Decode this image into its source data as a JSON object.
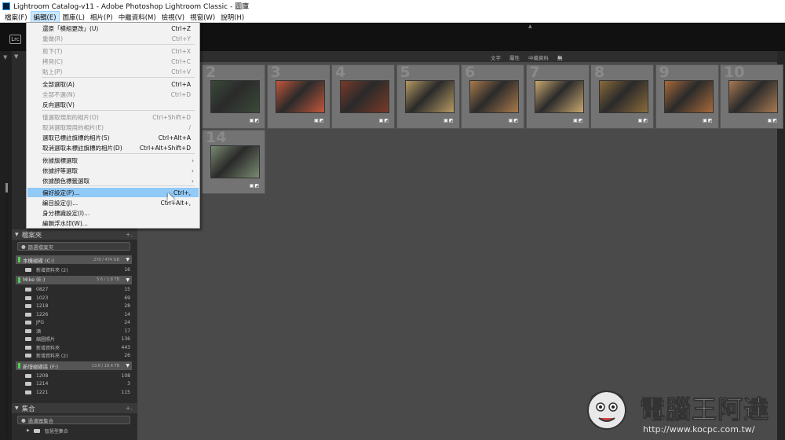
{
  "window": {
    "title": "Lightroom Catalog-v11 - Adobe Photoshop Lightroom Classic - 圖庫"
  },
  "menubar": [
    "檔案(F)",
    "編輯(E)",
    "圖庫(L)",
    "相片(P)",
    "中繼資料(M)",
    "檢視(V)",
    "視窗(W)",
    "說明(H)"
  ],
  "menubar_active": "編輯(E)",
  "identity": {
    "badge": "Lrc"
  },
  "filter_bar": {
    "text": "文字",
    "attribute": "屬性",
    "metadata": "中繼資料",
    "none": "無"
  },
  "edit_menu": {
    "items": [
      {
        "label": "還原「模組更改」(U)",
        "shortcut": "Ctrl+Z",
        "disabled": false
      },
      {
        "label": "重做(R)",
        "shortcut": "Ctrl+Y",
        "disabled": true
      },
      {
        "label": "剪下(T)",
        "shortcut": "Ctrl+X",
        "disabled": true
      },
      {
        "label": "拷貝(C)",
        "shortcut": "Ctrl+C",
        "disabled": true
      },
      {
        "label": "貼上(P)",
        "shortcut": "Ctrl+V",
        "disabled": true
      },
      {
        "label": "全部選取(A)",
        "shortcut": "Ctrl+A",
        "disabled": false
      },
      {
        "label": "全部不選(N)",
        "shortcut": "Ctrl+D",
        "disabled": true
      },
      {
        "label": "反向選取(V)",
        "shortcut": "",
        "disabled": false
      },
      {
        "label": "僅選取現用的相片(O)",
        "shortcut": "Ctrl+Shift+D",
        "disabled": true
      },
      {
        "label": "取消選取現用的相片(E)",
        "shortcut": "/",
        "disabled": true
      },
      {
        "label": "選取已標註旗標的相片(S)",
        "shortcut": "Ctrl+Alt+A",
        "disabled": false
      },
      {
        "label": "取消選取未標註旗標的相片(D)",
        "shortcut": "Ctrl+Alt+Shift+D",
        "disabled": false
      },
      {
        "label": "依據旗標選取",
        "submenu": true
      },
      {
        "label": "依據評等選取",
        "submenu": true
      },
      {
        "label": "依據顏色標籤選取",
        "submenu": true
      },
      {
        "label": "偏好設定(P)...",
        "shortcut": "Ctrl+,",
        "highlighted": true
      },
      {
        "label": "編目設定(J)...",
        "shortcut": "Ctrl+Alt+,",
        "disabled": false
      },
      {
        "label": "身分標識設定(I)...",
        "shortcut": "",
        "disabled": false
      },
      {
        "label": "編輯浮水印(W)...",
        "shortcut": "",
        "disabled": false
      }
    ]
  },
  "folders_panel": {
    "header": "檔案夾",
    "search_placeholder": "篩選檔案夾",
    "volumes": [
      {
        "name": "本機磁碟 (C:)",
        "capacity": "270 / 474 GB",
        "folders": [
          {
            "name": "新增資料夾 (2)",
            "count": "16"
          }
        ]
      },
      {
        "name": "Mike (E:)",
        "capacity": "5.6 / 1.8 TB",
        "folders": [
          {
            "name": "0827",
            "count": "15"
          },
          {
            "name": "1023",
            "count": "69"
          },
          {
            "name": "1218",
            "count": "28"
          },
          {
            "name": "1226",
            "count": "14"
          },
          {
            "name": "JPG",
            "count": "24"
          },
          {
            "name": "酒",
            "count": "17"
          },
          {
            "name": "縮圖照片",
            "count": "136"
          },
          {
            "name": "新增資料夾",
            "count": "443"
          },
          {
            "name": "新增資料夾 (2)",
            "count": "26"
          }
        ]
      },
      {
        "name": "新增磁碟區 (F:)",
        "capacity": "13.6 / 16.4 TB",
        "folders": [
          {
            "name": "1208",
            "count": "108"
          },
          {
            "name": "1214",
            "count": "3"
          },
          {
            "name": "1221",
            "count": "115"
          }
        ]
      }
    ]
  },
  "collections_panel": {
    "header": "集合",
    "search_placeholder": "過濾器集合",
    "items": [
      {
        "name": "智慧型集合"
      }
    ]
  },
  "grid": {
    "cells": [
      {
        "num": "2",
        "color": "#3a4a3a"
      },
      {
        "num": "3",
        "color": "#c2563a"
      },
      {
        "num": "4",
        "color": "#7a3a28"
      },
      {
        "num": "5",
        "color": "#b69a62"
      },
      {
        "num": "6",
        "color": "#a87a4a"
      },
      {
        "num": "7",
        "color": "#c9a870"
      },
      {
        "num": "8",
        "color": "#8a6a3a"
      },
      {
        "num": "9",
        "color": "#a86a3a"
      },
      {
        "num": "10",
        "color": "#a87a52"
      },
      {
        "num": "14",
        "color": "#7a8a70"
      }
    ]
  },
  "watermark": {
    "brand": "電腦王阿達",
    "url": "http://www.kocpc.com.tw/"
  }
}
